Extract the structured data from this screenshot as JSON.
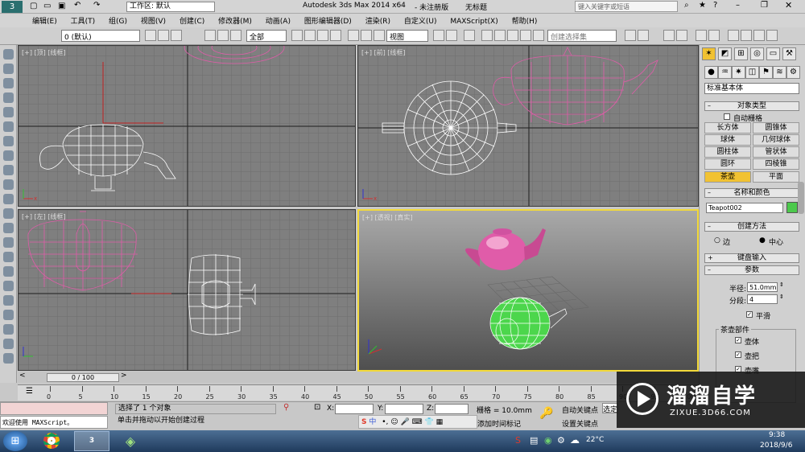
{
  "titlebar": {
    "workspace_label": "工作区: 默认",
    "app_title": "Autodesk 3ds Max  2014 x64",
    "edition": "- 未注册版",
    "doc_title": "无标题",
    "search_placeholder": "键入关键字或短语"
  },
  "menu": [
    "编辑(E)",
    "工具(T)",
    "组(G)",
    "视图(V)",
    "创建(C)",
    "修改器(M)",
    "动画(A)",
    "图形编辑器(D)",
    "渲染(R)",
    "自定义(U)",
    "MAXScript(X)",
    "帮助(H)"
  ],
  "toolbar": {
    "layer_select": "0 (默认)",
    "filter_select": "全部",
    "coord_select": "视图",
    "selection_set_placeholder": "创建选择集"
  },
  "viewports": {
    "top": "[+] [顶] [线框]",
    "front": "[+] [前] [线框]",
    "left": "[+] [左] [线框]",
    "persp": "[+] [透视] [真实]"
  },
  "timeline": {
    "frame": "0 / 100"
  },
  "ruler_ticks": [
    "0",
    "5",
    "10",
    "15",
    "20",
    "25",
    "30",
    "35",
    "40",
    "45",
    "50",
    "55",
    "60",
    "65",
    "70",
    "75",
    "80",
    "85",
    "90",
    "95",
    "100"
  ],
  "cmd_panel": {
    "category_select": "标准基本体",
    "object_type_title": "对象类型",
    "autogrid_label": "自动栅格",
    "objects": [
      "长方体",
      "圆锥体",
      "球体",
      "几何球体",
      "圆柱体",
      "管状体",
      "圆环",
      "四棱锥",
      "茶壶",
      "平面"
    ],
    "active_object": "茶壶",
    "name_color_title": "名称和颜色",
    "name_value": "Teapot002",
    "name_color": "#4cc94c",
    "creation_method_title": "创建方法",
    "method_edge": "边",
    "method_center": "中心",
    "keyboard_entry_title": "键盘输入",
    "params_title": "参数",
    "radius_label": "半径:",
    "radius_value": "51.0mm",
    "segments_label": "分段:",
    "segments_value": "4",
    "smooth_label": "平滑",
    "parts_title": "茶壶部件",
    "part_body": "壶体",
    "part_handle": "壶把",
    "part_spout": "壶嘴"
  },
  "status": {
    "maxscript_welcome": "欢迎使用 MAXScript。",
    "selected_text": "选择了 1 个对象",
    "prompt_text": "单击并拖动以开始创建过程",
    "x_label": "X:",
    "y_label": "Y:",
    "z_label": "Z:",
    "grid_text": "栅格 = 10.0mm",
    "auto_key": "自动关键点",
    "set_key": "设置关键点",
    "selected_short": "选定",
    "add_time_tag": "添加时间标记",
    "ime": "中"
  },
  "watermark": {
    "brand": "溜溜自学",
    "url": "ZIXUE.3D66.COM"
  },
  "taskbar": {
    "temperature": "22°C",
    "time": "9:38",
    "date": "2018/9/6"
  },
  "colors": {
    "teapot_pink": "#e05ca9",
    "teapot_white": "#ffffff",
    "teapot_green": "#4cd64c",
    "active_viewport_border": "#f2d93a",
    "active_button": "#f1c232"
  }
}
